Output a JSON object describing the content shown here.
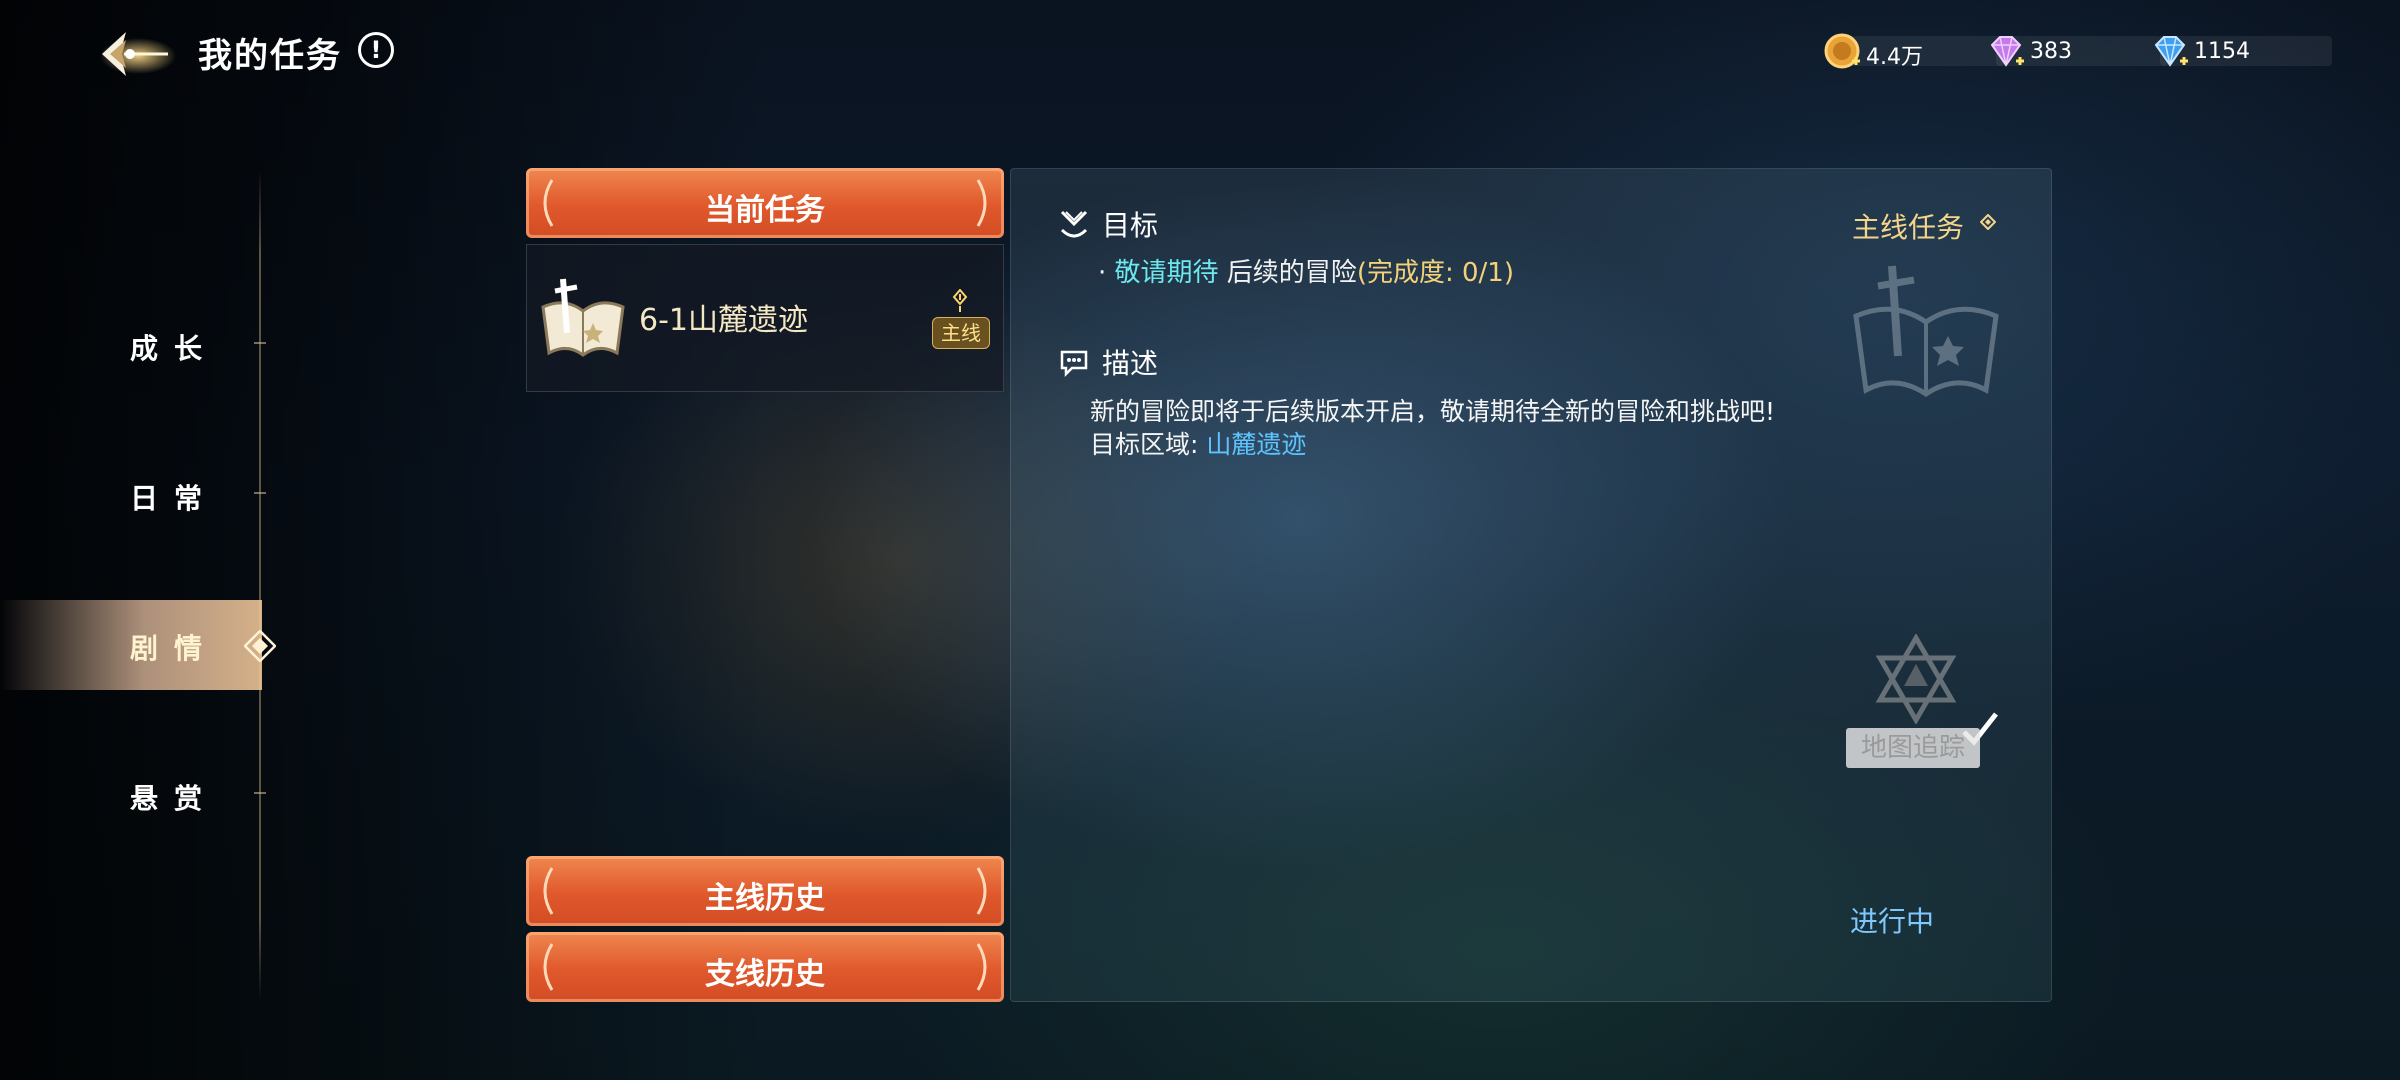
{
  "header": {
    "title": "我的任务",
    "info_icon": "!",
    "currencies": [
      {
        "icon": "gold-coin-icon",
        "value": "4.4万"
      },
      {
        "icon": "purple-gem-icon",
        "value": "383"
      },
      {
        "icon": "blue-diamond-icon",
        "value": "1154"
      }
    ]
  },
  "nav": {
    "items": [
      {
        "label": "成长",
        "active": false
      },
      {
        "label": "日常",
        "active": false
      },
      {
        "label": "剧情",
        "active": true
      },
      {
        "label": "悬赏",
        "active": false
      }
    ]
  },
  "task_list": {
    "current_tab": "当前任务",
    "tasks": [
      {
        "name": "6-1山麓遗迹",
        "badge": "主线",
        "icon": "book-sword-icon"
      }
    ],
    "main_history": "主线历史",
    "side_history": "支线历史"
  },
  "detail": {
    "type_label": "主线任务",
    "objective_title": "目标",
    "objective": {
      "bullet": "·",
      "highlight": "敬请期待",
      "text": " 后续的冒险",
      "progress": "(完成度: 0/1)"
    },
    "description_title": "描述",
    "description_line1": "新的冒险即将于后续版本开启，敬请期待全新的冒险和挑战吧!",
    "target_area_label": "目标区域: ",
    "target_area": "山麓遗迹",
    "map_track_label": "地图追踪",
    "status": "进行中"
  },
  "colors": {
    "accent_orange": "#e0582c",
    "highlight_cyan": "#6ce8ee",
    "area_blue": "#5ec4ff",
    "progress_gold": "#f3d27a",
    "status_blue": "#7fc7ff"
  }
}
